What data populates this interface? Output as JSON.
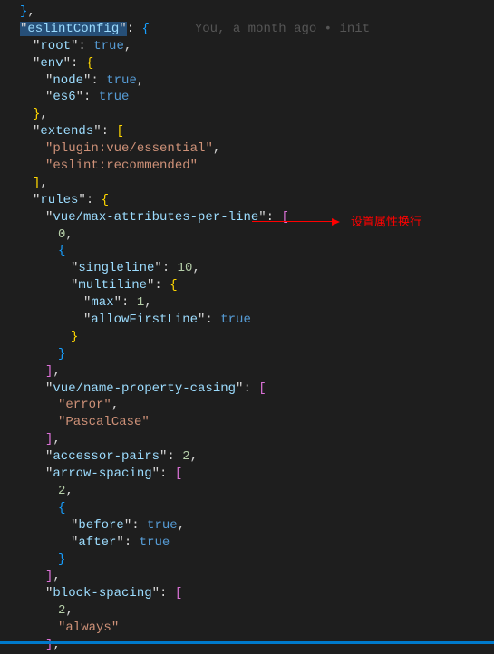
{
  "gitlens": "You, a month ago • init",
  "annotation": "设置属性换行",
  "tokens": {
    "eslintConfig": "eslintConfig",
    "root": "root",
    "env": "env",
    "node": "node",
    "es6": "es6",
    "extends": "extends",
    "plugin_vue": "plugin:vue/essential",
    "eslint_rec": "eslint:recommended",
    "rules": "rules",
    "vue_max_attr": "vue/max-attributes-per-line",
    "singleline": "singleline",
    "multiline": "multiline",
    "max": "max",
    "allowFirstLine": "allowFirstLine",
    "vue_name_casing": "vue/name-property-casing",
    "error": "error",
    "pascalcase": "PascalCase",
    "accessor_pairs": "accessor-pairs",
    "arrow_spacing": "arrow-spacing",
    "before": "before",
    "after": "after",
    "block_spacing": "block-spacing",
    "always": "always"
  },
  "nums": {
    "zero": "0",
    "one": "1",
    "two": "2",
    "ten": "10"
  },
  "bools": {
    "true": "true"
  },
  "punc": {
    "q": "\"",
    "colon": ": ",
    "colonn": ":",
    "obr": "{",
    "cbr": "}",
    "osq": "[",
    "csq": "]",
    "comma": ",",
    "brcomma": "},",
    "sqcomma": "],"
  }
}
